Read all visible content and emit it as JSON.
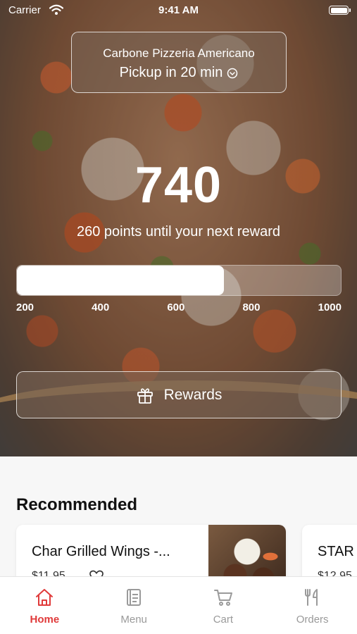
{
  "status_bar": {
    "carrier": "Carrier",
    "time": "9:41 AM"
  },
  "location": {
    "restaurant": "Carbone Pizzeria Americano",
    "pickup": "Pickup in 20 min"
  },
  "points": {
    "value": "740",
    "message": "260 points until your next reward",
    "progress_fraction": 0.64,
    "ticks": [
      "200",
      "400",
      "600",
      "800",
      "1000"
    ]
  },
  "rewards_button": {
    "label": "Rewards",
    "icon": "gift-icon"
  },
  "recommended": {
    "title": "Recommended",
    "items": [
      {
        "name": "Char Grilled Wings -...",
        "price": "$11.95"
      },
      {
        "name": "STAR",
        "price": "$12.95"
      }
    ]
  },
  "tabs": [
    {
      "label": "Home",
      "icon": "home-icon",
      "active": true
    },
    {
      "label": "Menu",
      "icon": "menu-icon",
      "active": false
    },
    {
      "label": "Cart",
      "icon": "cart-icon",
      "active": false
    },
    {
      "label": "Orders",
      "icon": "orders-icon",
      "active": false
    }
  ],
  "colors": {
    "accent": "#e03a3a",
    "inactive_tab": "#9a9a9a"
  }
}
